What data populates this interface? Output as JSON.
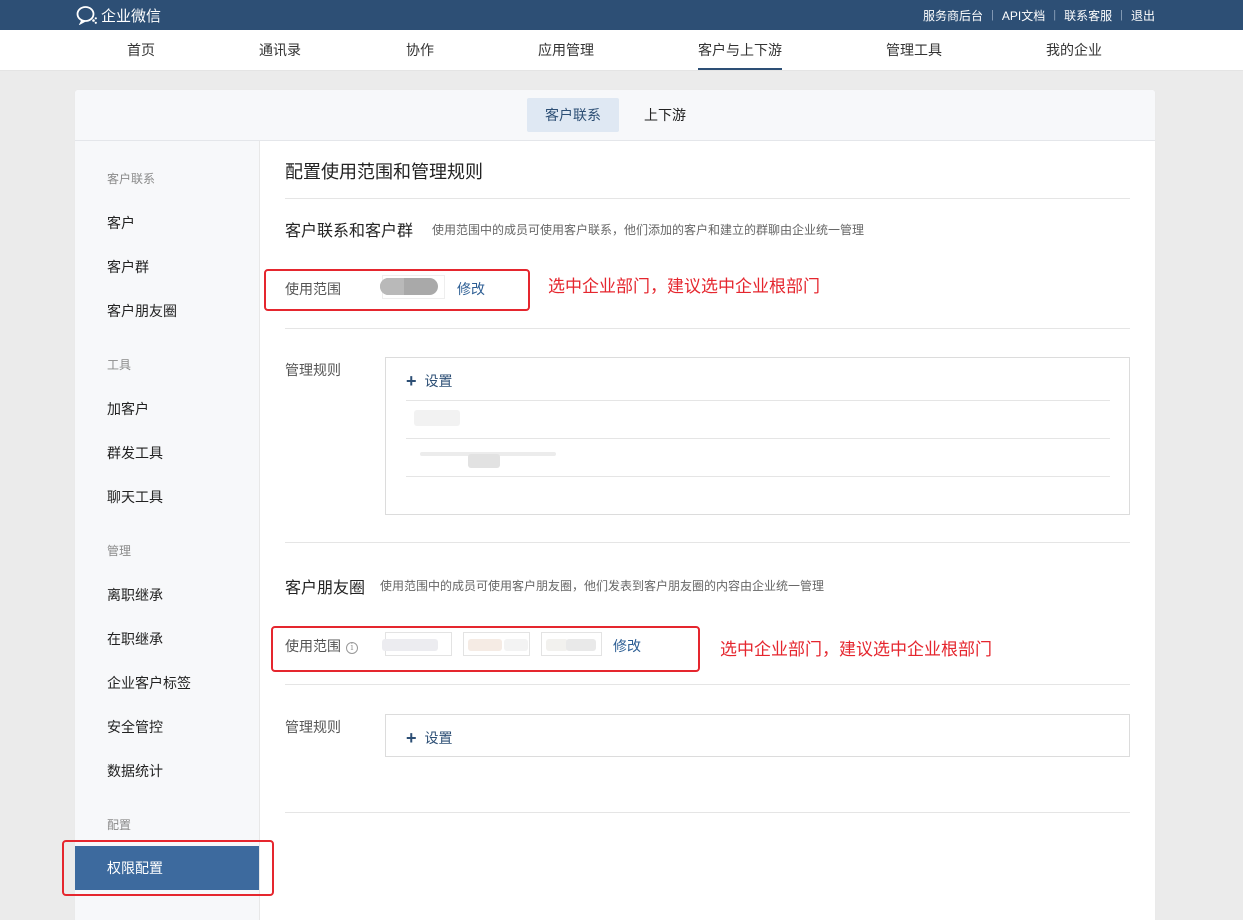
{
  "topbar": {
    "brand": "企业微信",
    "links": [
      "服务商后台",
      "API文档",
      "联系客服",
      "退出"
    ],
    "separator": "|"
  },
  "nav": {
    "items": [
      "首页",
      "通讯录",
      "协作",
      "应用管理",
      "客户与上下游",
      "管理工具",
      "我的企业"
    ],
    "active": "客户与上下游"
  },
  "subtabs": {
    "items": [
      "客户联系",
      "上下游"
    ],
    "active": "客户联系"
  },
  "sidebar": {
    "groups": [
      {
        "heading": "客户联系",
        "items": [
          "客户",
          "客户群",
          "客户朋友圈"
        ]
      },
      {
        "heading": "工具",
        "items": [
          "加客户",
          "群发工具",
          "聊天工具"
        ]
      },
      {
        "heading": "管理",
        "items": [
          "离职继承",
          "在职继承",
          "企业客户标签",
          "安全管控",
          "数据统计"
        ]
      },
      {
        "heading": "配置",
        "items": [
          "权限配置"
        ]
      }
    ],
    "active": "权限配置"
  },
  "main": {
    "title": "配置使用范围和管理规则",
    "section1": {
      "title": "客户联系和客户群",
      "desc": "使用范围中的成员可使用客户联系，他们添加的客户和建立的群聊由企业统一管理",
      "scope_label": "使用范围",
      "modify_label": "修改",
      "rules_label": "管理规则",
      "add_label": "设置"
    },
    "section2": {
      "title": "客户朋友圈",
      "desc": "使用范围中的成员可使用客户朋友圈，他们发表到客户朋友圈的内容由企业统一管理",
      "scope_label": "使用范围",
      "info_icon": "i",
      "modify_label": "修改",
      "rules_label": "管理规则",
      "add_label": "设置"
    }
  },
  "annotations": {
    "note1": "选中企业部门，建议选中企业根部门",
    "note2": "选中企业部门，建议选中企业根部门"
  },
  "colors": {
    "topbar": "#2d4f75",
    "accent": "#2d5e94",
    "sidebar_active": "#3d6a9e",
    "annotation": "#e5262e"
  },
  "icons": {
    "brand": "wechat-work-logo-icon",
    "add": "plus-icon",
    "info": "info-circle-icon"
  }
}
